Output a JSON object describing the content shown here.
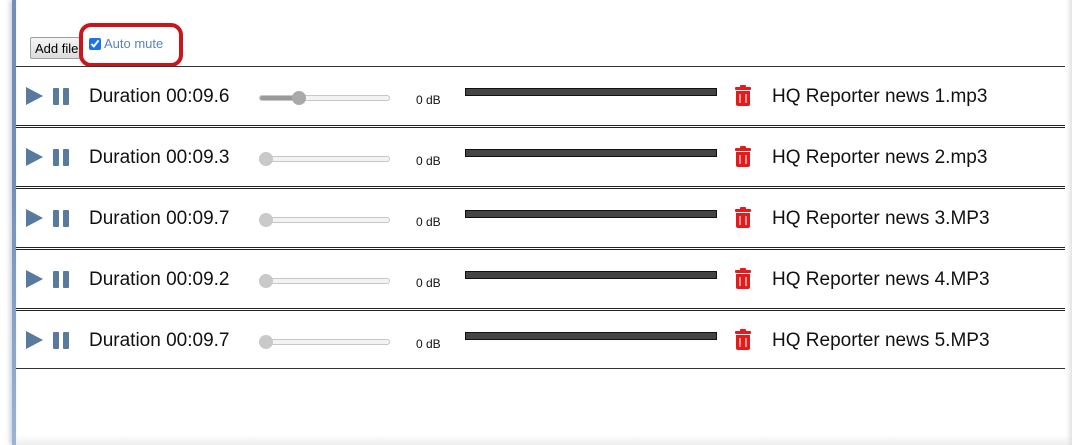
{
  "toolbar": {
    "add_file_label": "Add file",
    "auto_mute_label": "Auto mute",
    "auto_mute_checked": true
  },
  "tracks": [
    {
      "duration": "Duration 00:09.6",
      "gain": "0 dB",
      "volume_fraction": 0.3,
      "filename": "HQ Reporter news 1.mp3"
    },
    {
      "duration": "Duration 00:09.3",
      "gain": "0 dB",
      "volume_fraction": 0.0,
      "filename": "HQ Reporter news 2.mp3"
    },
    {
      "duration": "Duration 00:09.7",
      "gain": "0 dB",
      "volume_fraction": 0.0,
      "filename": "HQ Reporter news 3.MP3"
    },
    {
      "duration": "Duration 00:09.2",
      "gain": "0 dB",
      "volume_fraction": 0.0,
      "filename": "HQ Reporter news 4.MP3"
    },
    {
      "duration": "Duration 00:09.7",
      "gain": "0 dB",
      "volume_fraction": 0.0,
      "filename": "HQ Reporter news 5.MP3"
    }
  ],
  "icons": {
    "play": "play-icon",
    "pause": "pause-icon",
    "delete": "trash-icon"
  },
  "colors": {
    "control_blue": "#577a9e",
    "delete_red": "#e51a1a",
    "highlight_red": "#c8161d",
    "link_blue": "#5b84b4"
  }
}
